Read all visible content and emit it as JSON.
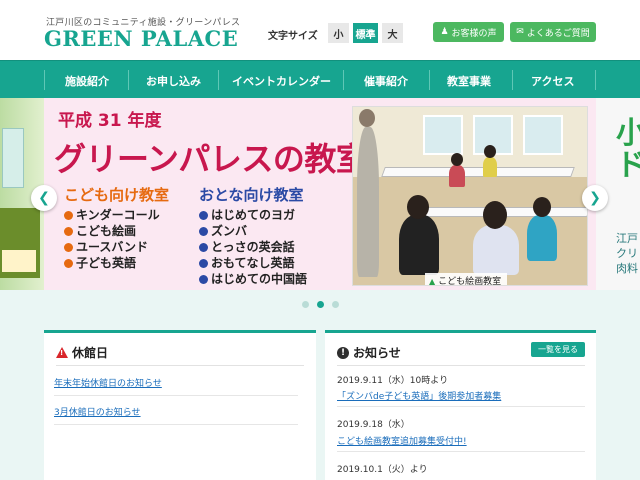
{
  "header": {
    "tagline": "江戸川区のコミュニティ施設・グリーンパレス",
    "logo": "GREEN PALACE",
    "font_size_label": "文字サイズ",
    "font_sizes": [
      "小",
      "標準",
      "大"
    ],
    "active_font_size": "標準",
    "voice_button": "お客様の声",
    "faq_button": "よくあるご質問"
  },
  "nav": {
    "items": [
      "施設紹介",
      "お申し込み",
      "イベントカレンダー",
      "催事紹介",
      "教室事業",
      "アクセス"
    ]
  },
  "slider": {
    "title_line1": "平成 31 年度",
    "title_line2": "グリーンパレスの教室事業",
    "kids_heading": "こども向け教室",
    "kids_items": [
      "キンダーコール",
      "こども絵画",
      "ユースバンド",
      "子ども英語"
    ],
    "adult_heading": "おとな向け教室",
    "adult_items": [
      "はじめてのヨガ",
      "ズンバ",
      "とっさの英会話",
      "おもてなし英語",
      "はじめての中国語"
    ],
    "photo_caption": "こども絵画教室",
    "right_peek_big": "小\nド",
    "right_peek_small": "江戸\nクリ\n肉料",
    "dots": 3,
    "active_dot": 2
  },
  "closed_panel": {
    "heading": "休館日",
    "links": [
      "年末年始休館日のお知らせ",
      "3月休館日のお知らせ"
    ]
  },
  "news_panel": {
    "heading": "お知らせ",
    "more_button": "一覧を見る",
    "items": [
      {
        "date": "2019.9.11（水）10時より",
        "link": "「ズンバde子ども英語」後期参加者募集"
      },
      {
        "date": "2019.9.18（水）",
        "link": "こども絵画教室追加募集受付中!"
      },
      {
        "date": "2019.10.1（火）より",
        "link": ""
      }
    ]
  },
  "colors": {
    "brand": "#17a590",
    "button_green": "#4cb860",
    "title_red": "#c8174e",
    "kids_orange": "#e66a10",
    "adult_blue": "#2b4aa5",
    "link_blue": "#1a6dbb"
  }
}
